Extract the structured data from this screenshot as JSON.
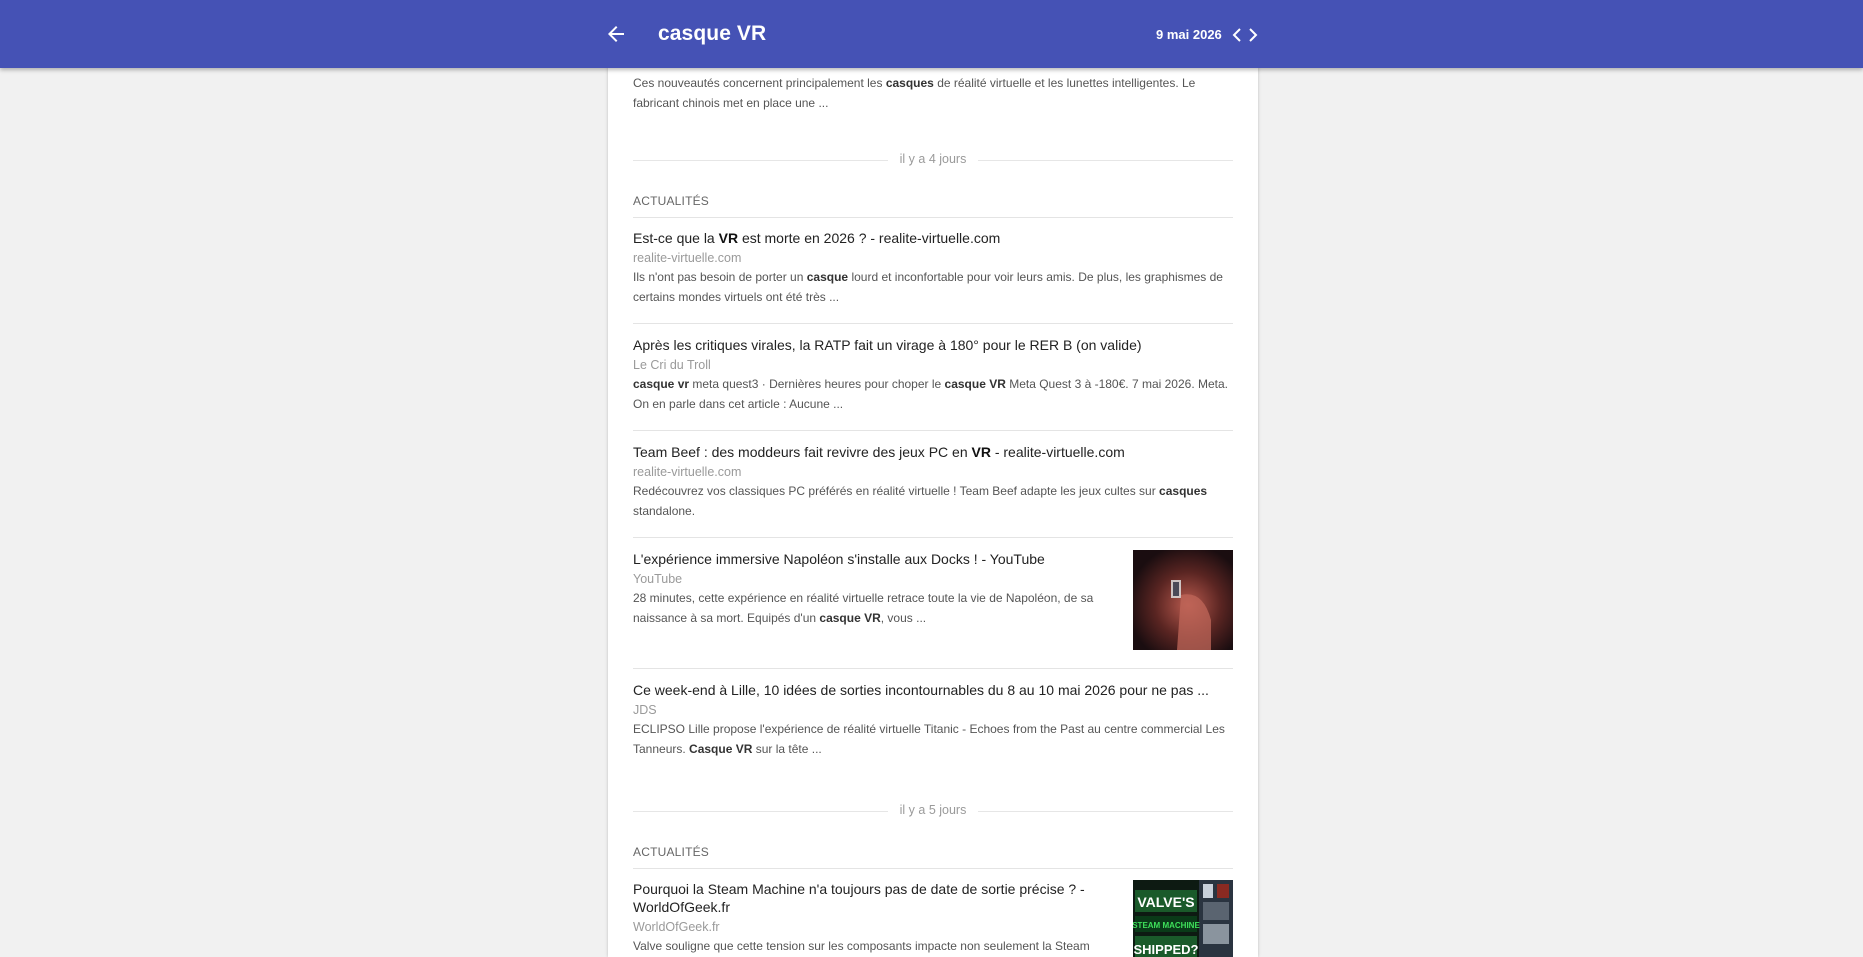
{
  "header": {
    "title": "casque VR",
    "date": "9 mai 2026"
  },
  "top_snippet": {
    "parts": [
      {
        "t": "Ces nouveautés concernent principalement les "
      },
      {
        "t": "casques",
        "b": true
      },
      {
        "t": " de réalité virtuelle et les lunettes intelligentes. Le fabricant chinois met en place une ..."
      }
    ]
  },
  "groups": [
    {
      "divider": "il y a 4 jours",
      "section": "ACTUALITÉS",
      "items": [
        {
          "title": [
            {
              "t": "Est-ce que la "
            },
            {
              "t": "VR",
              "b": true
            },
            {
              "t": " est morte en 2026 ? - realite-virtuelle.com"
            }
          ],
          "source": "realite-virtuelle.com",
          "snippet": [
            {
              "t": "Ils n'ont pas besoin de porter un "
            },
            {
              "t": "casque",
              "b": true
            },
            {
              "t": " lourd et inconfortable pour voir leurs amis. De plus, les graphismes de certains mondes virtuels ont été très ..."
            }
          ]
        },
        {
          "title": [
            {
              "t": "Après les critiques virales, la RATP fait un virage à 180° pour le RER B (on valide)"
            }
          ],
          "source": "Le Cri du Troll",
          "snippet": [
            {
              "t": "casque vr",
              "b": true
            },
            {
              "t": " meta quest3 · Dernières heures pour choper le "
            },
            {
              "t": "casque VR",
              "b": true
            },
            {
              "t": " Meta Quest 3 à -180€. 7 mai 2026. Meta. On en parle dans cet article : Aucune ..."
            }
          ]
        },
        {
          "title": [
            {
              "t": "Team Beef : des moddeurs fait revivre des jeux PC en "
            },
            {
              "t": "VR",
              "b": true
            },
            {
              "t": " - realite-virtuelle.com"
            }
          ],
          "source": "realite-virtuelle.com",
          "snippet": [
            {
              "t": "Redécouvrez vos classiques PC préférés en réalité virtuelle ! Team Beef adapte les jeux cultes sur "
            },
            {
              "t": "casques",
              "b": true
            },
            {
              "t": " standalone."
            }
          ]
        },
        {
          "title": [
            {
              "t": "L'expérience immersive Napoléon s'installe aux Docks ! - YouTube"
            }
          ],
          "source": "YouTube",
          "snippet": [
            {
              "t": "28 minutes, cette expérience en réalité virtuelle retrace toute la vie de Napoléon, de sa naissance à sa mort. Equipés d'un "
            },
            {
              "t": "casque VR",
              "b": true
            },
            {
              "t": ", vous ..."
            }
          ],
          "thumb": "video-thumbnail"
        },
        {
          "title": [
            {
              "t": "Ce week-end à Lille, 10 idées de sorties incontournables du 8 au 10 mai 2026 pour ne pas ..."
            }
          ],
          "source": "JDS",
          "snippet": [
            {
              "t": "ECLIPSO Lille propose l'expérience de réalité virtuelle Titanic - Echoes from the Past au centre commercial Les Tanneurs. "
            },
            {
              "t": "Casque VR",
              "b": true
            },
            {
              "t": " sur la tête ..."
            }
          ]
        }
      ]
    },
    {
      "divider": "il y a 5 jours",
      "section": "ACTUALITÉS",
      "items": [
        {
          "title": [
            {
              "t": "Pourquoi la Steam Machine n'a toujours pas de date de sortie précise ? - WorldOfGeek.fr"
            }
          ],
          "source": "WorldOfGeek.fr",
          "snippet": [
            {
              "t": "Valve souligne que cette tension sur les composants impacte non seulement la Steam"
            }
          ],
          "thumb": "steam-thumbnail",
          "thumb_text": [
            "VALVE'S",
            "STEAM MACHINE",
            "SHIPPED?"
          ]
        }
      ]
    }
  ]
}
